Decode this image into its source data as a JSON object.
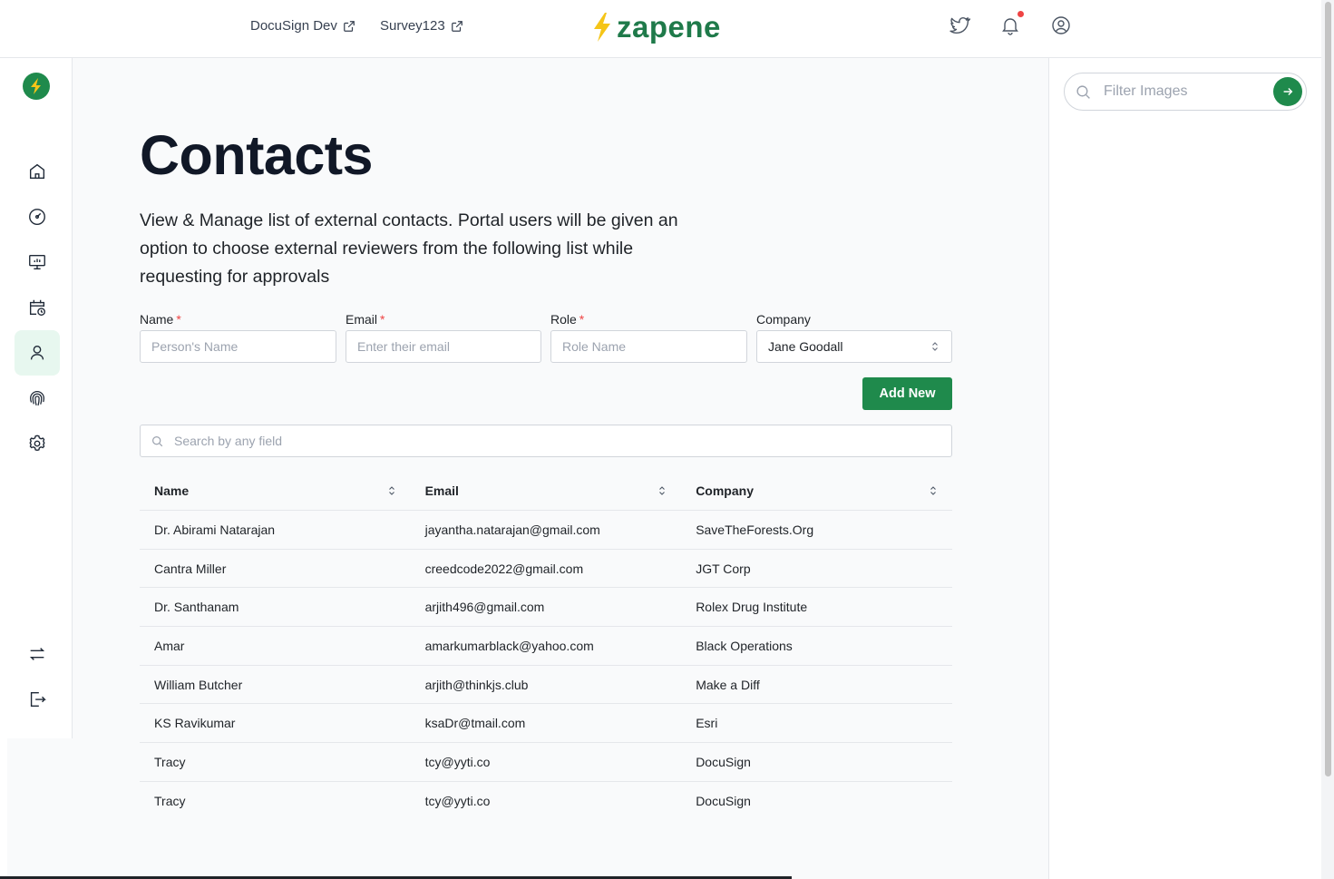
{
  "header": {
    "links": [
      {
        "label": "DocuSign Dev"
      },
      {
        "label": "Survey123"
      }
    ],
    "brand": "zapene",
    "colors": {
      "brand": "#1f7a4a",
      "accent": "#1f8a4c",
      "bolt": "#f5c518",
      "notification": "#ef4444"
    }
  },
  "sidebar": {
    "items": [
      {
        "icon": "home-icon"
      },
      {
        "icon": "dashboard-gauge-icon"
      },
      {
        "icon": "presentation-chart-icon"
      },
      {
        "icon": "calendar-clock-icon"
      },
      {
        "icon": "user-icon",
        "active": true
      },
      {
        "icon": "fingerprint-icon"
      },
      {
        "icon": "gear-icon"
      },
      {
        "icon": "swap-arrows-icon"
      },
      {
        "icon": "logout-icon"
      }
    ]
  },
  "main": {
    "title": "Contacts",
    "description": "View & Manage list of external contacts. Portal users will be given an option to choose external reviewers from the following list while requesting for approvals",
    "form": {
      "name_label": "Name",
      "name_placeholder": "Person's Name",
      "email_label": "Email",
      "email_placeholder": "Enter their email",
      "role_label": "Role",
      "role_placeholder": "Role Name",
      "company_label": "Company",
      "company_selected": "Jane Goodall",
      "required_mark": "*",
      "add_button": "Add New"
    },
    "search_placeholder": "Search by any field",
    "table": {
      "headers": [
        "Name",
        "Email",
        "Company"
      ],
      "rows": [
        [
          "Dr. Abirami Natarajan",
          "jayantha.natarajan@gmail.com",
          "SaveTheForests.Org"
        ],
        [
          "Cantra Miller",
          "creedcode2022@gmail.com",
          "JGT Corp"
        ],
        [
          "Dr. Santhanam",
          "arjith496@gmail.com",
          "Rolex Drug Institute"
        ],
        [
          "Amar",
          "amarkumarblack@yahoo.com",
          "Black Operations"
        ],
        [
          "William Butcher",
          "arjith@thinkjs.club",
          "Make a Diff"
        ],
        [
          "KS Ravikumar",
          "ksaDr@tmail.com",
          "Esri"
        ],
        [
          "Tracy",
          "tcy@yyti.co",
          "DocuSign"
        ],
        [
          "Tracy",
          "tcy@yyti.co",
          "DocuSign"
        ]
      ]
    }
  },
  "right_panel": {
    "filter_placeholder": "Filter Images"
  }
}
